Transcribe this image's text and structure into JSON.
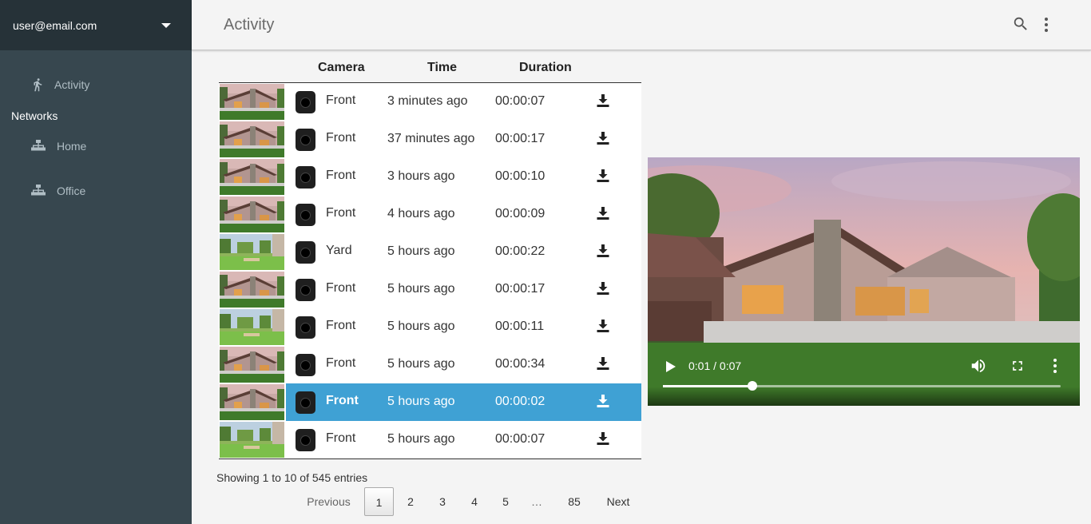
{
  "sidebar": {
    "user": "user@email.com",
    "activity_label": "Activity",
    "networks_heading": "Networks",
    "networks": [
      {
        "label": "Home"
      },
      {
        "label": "Office"
      }
    ]
  },
  "header": {
    "title": "Activity",
    "search_icon": "search-icon",
    "more_icon": "more-vert-icon"
  },
  "table": {
    "columns": [
      "Camera",
      "Time",
      "Duration"
    ],
    "rows": [
      {
        "camera": "Front",
        "time": "3 minutes ago",
        "duration": "00:00:07",
        "thumb": "front"
      },
      {
        "camera": "Front",
        "time": "37 minutes ago",
        "duration": "00:00:17",
        "thumb": "front"
      },
      {
        "camera": "Front",
        "time": "3 hours ago",
        "duration": "00:00:10",
        "thumb": "front"
      },
      {
        "camera": "Front",
        "time": "4 hours ago",
        "duration": "00:00:09",
        "thumb": "front"
      },
      {
        "camera": "Yard",
        "time": "5 hours ago",
        "duration": "00:00:22",
        "thumb": "yard"
      },
      {
        "camera": "Front",
        "time": "5 hours ago",
        "duration": "00:00:17",
        "thumb": "front"
      },
      {
        "camera": "Front",
        "time": "5 hours ago",
        "duration": "00:00:11",
        "thumb": "yard"
      },
      {
        "camera": "Front",
        "time": "5 hours ago",
        "duration": "00:00:34",
        "thumb": "front"
      },
      {
        "camera": "Front",
        "time": "5 hours ago",
        "duration": "00:00:02",
        "thumb": "front",
        "selected": true
      },
      {
        "camera": "Front",
        "time": "5 hours ago",
        "duration": "00:00:07",
        "thumb": "yard"
      }
    ]
  },
  "info": "Showing 1 to 10 of 545 entries",
  "pagination": {
    "previous": "Previous",
    "pages": [
      "1",
      "2",
      "3",
      "4",
      "5",
      "…",
      "85"
    ],
    "active": "1",
    "next": "Next"
  },
  "video": {
    "time": "0:01 / 0:07",
    "progress": 0.225
  },
  "colors": {
    "sidebar": "#37474f",
    "sidebar_header": "#263238",
    "selected_row": "#3fa1d4"
  }
}
